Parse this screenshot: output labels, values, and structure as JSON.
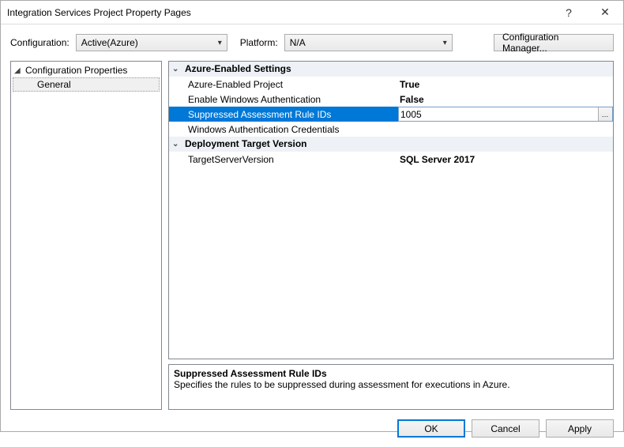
{
  "window": {
    "title": "Integration Services Project Property Pages",
    "help": "?",
    "close": "✕"
  },
  "config": {
    "config_label": "Configuration:",
    "config_value": "Active(Azure)",
    "platform_label": "Platform:",
    "platform_value": "N/A",
    "manager_button": "Configuration Manager..."
  },
  "tree": {
    "root": "Configuration Properties",
    "child": "General"
  },
  "grid": {
    "cat1": "Azure-Enabled Settings",
    "rows1": [
      {
        "label": "Azure-Enabled Project",
        "value": "True"
      },
      {
        "label": "Enable Windows Authentication",
        "value": "False"
      },
      {
        "label": "Suppressed Assessment Rule IDs",
        "value": "1005",
        "selected": true
      },
      {
        "label": "Windows Authentication Credentials",
        "value": ""
      }
    ],
    "cat2": "Deployment Target Version",
    "rows2": [
      {
        "label": "TargetServerVersion",
        "value": "SQL Server 2017"
      }
    ]
  },
  "desc": {
    "title": "Suppressed Assessment Rule IDs",
    "body": "Specifies the rules to be suppressed during assessment for executions in Azure."
  },
  "buttons": {
    "ok": "OK",
    "cancel": "Cancel",
    "apply": "Apply"
  }
}
